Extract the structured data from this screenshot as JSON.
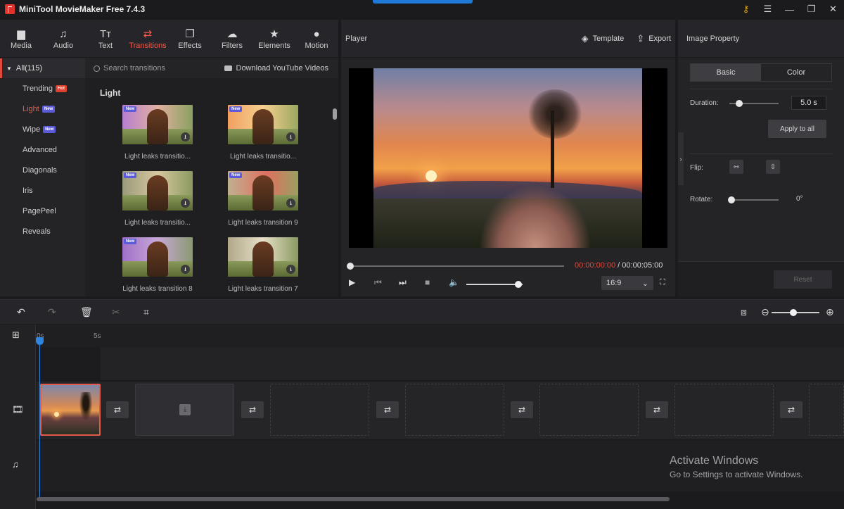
{
  "app": {
    "title": "MiniTool MovieMaker Free 7.4.3"
  },
  "window_controls": {
    "key": "⚷",
    "menu": "☰",
    "minimize": "—",
    "maximize": "❐",
    "close": "✕"
  },
  "tabs": [
    {
      "label": "Media",
      "icon": "▆"
    },
    {
      "label": "Audio",
      "icon": "♫"
    },
    {
      "label": "Text",
      "icon": "Tт"
    },
    {
      "label": "Transitions",
      "icon": "⇄"
    },
    {
      "label": "Effects",
      "icon": "❐"
    },
    {
      "label": "Filters",
      "icon": "☁"
    },
    {
      "label": "Elements",
      "icon": "★"
    },
    {
      "label": "Motion",
      "icon": "●"
    }
  ],
  "sidebar": {
    "header": "All(115)",
    "items": [
      {
        "label": "Trending",
        "badge": "Hot"
      },
      {
        "label": "Light",
        "badge": "New"
      },
      {
        "label": "Wipe",
        "badge": "New"
      },
      {
        "label": "Advanced",
        "badge": ""
      },
      {
        "label": "Diagonals",
        "badge": ""
      },
      {
        "label": "Iris",
        "badge": ""
      },
      {
        "label": "PagePeel",
        "badge": ""
      },
      {
        "label": "Reveals",
        "badge": ""
      }
    ]
  },
  "content": {
    "search_placeholder": "Search transitions",
    "download_link": "Download YouTube Videos",
    "section_title": "Light",
    "thumbnails": [
      {
        "label": "Light leaks transitio...",
        "badge": "New"
      },
      {
        "label": "Light leaks transitio...",
        "badge": "New"
      },
      {
        "label": "Light leaks transitio...",
        "badge": "New"
      },
      {
        "label": "Light leaks transition 9",
        "badge": "New"
      },
      {
        "label": "Light leaks transition 8",
        "badge": "New"
      },
      {
        "label": "Light leaks transition 7",
        "badge": ""
      }
    ]
  },
  "player": {
    "title": "Player",
    "template_label": "Template",
    "export_label": "Export",
    "current_time": "00:00:00:00",
    "separator": " / ",
    "total_time": "00:00:05:00",
    "aspect": "16:9",
    "seek_progress": 0,
    "volume_level": 0.92
  },
  "properties": {
    "title": "Image Property",
    "tab_basic": "Basic",
    "tab_color": "Color",
    "duration_label": "Duration:",
    "duration_value": "5.0 s",
    "apply_all": "Apply to all",
    "flip_label": "Flip:",
    "rotate_label": "Rotate:",
    "rotate_value": "0°",
    "reset": "Reset"
  },
  "timeline": {
    "ruler": [
      "0s",
      "5s"
    ],
    "zoom_level": 0.45
  },
  "watermark": {
    "line1": "Activate Windows",
    "line2": "Go to Settings to activate Windows."
  },
  "colors": {
    "accent": "#ef5b4a",
    "playhead": "#2f86e0",
    "titlebar_accent": "#1e7ad6"
  }
}
